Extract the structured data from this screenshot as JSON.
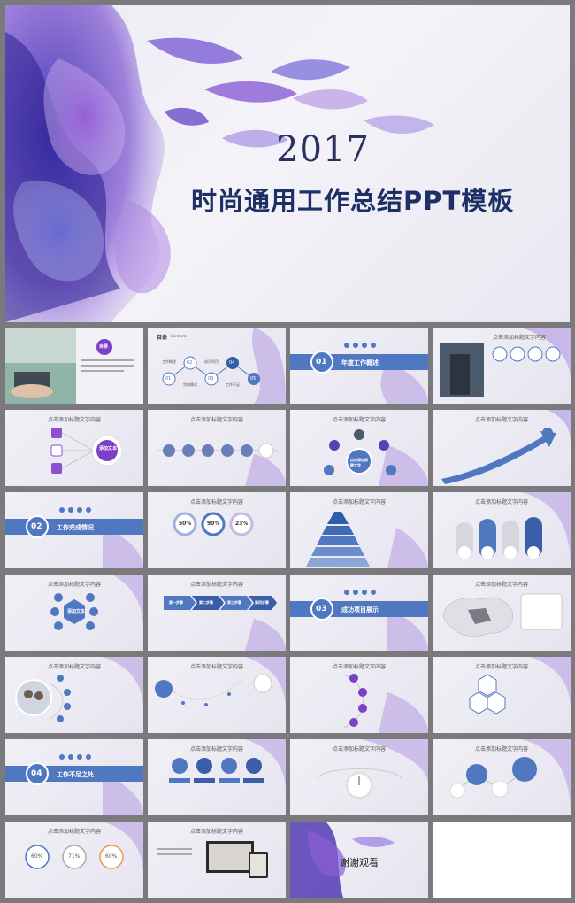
{
  "cover": {
    "year": "2017",
    "title": "时尚通用工作总结PPT模板"
  },
  "colors": {
    "accent": "#4f78c0",
    "violet": "#7b4fc8",
    "navy": "#1e2f66"
  },
  "thumbs": {
    "t1": {
      "badge": "目录"
    },
    "t2": {
      "title": "目录",
      "sub": "Contents",
      "n1": "01",
      "n2": "02",
      "n3": "03",
      "n4": "04",
      "n5": "05",
      "l1": "工作概述",
      "l2": "完成情况",
      "l3": "成功项目",
      "l4": "工作不足"
    },
    "t3": {
      "num": "01",
      "label": "年度工作概述"
    },
    "t4": {
      "heading": "点击添加标题文字内容"
    },
    "t5": {
      "heading": "点击添加标题文字内容",
      "center": "添加文本"
    },
    "t6": {
      "heading": "点击添加标题文字内容"
    },
    "t7": {
      "heading": "点击添加标题文字内容",
      "center": "点击添加标题文字"
    },
    "t8": {
      "heading": "点击添加标题文字内容"
    },
    "t9": {
      "num": "02",
      "label": "工作完成情况"
    },
    "t10": {
      "heading": "点击添加标题文字内容",
      "p1": "50%",
      "p2": "90%",
      "p3": "23%"
    },
    "t11": {
      "heading": "点击添加标题文字内容"
    },
    "t12": {
      "heading": "点击添加标题文字内容"
    },
    "t13": {
      "heading": "点击添加标题文字内容",
      "center": "添加文本"
    },
    "t14": {
      "heading": "点击添加标题文字内容",
      "a1": "第一步骤",
      "a2": "第二步骤",
      "a3": "第三步骤",
      "a4": "第四步骤"
    },
    "t15": {
      "num": "03",
      "label": "成功项目展示"
    },
    "t16": {
      "heading": "点击添加标题文字内容"
    },
    "t17": {
      "heading": "点击添加标题文字内容"
    },
    "t18": {
      "heading": "点击添加标题文字内容"
    },
    "t19": {
      "heading": "点击添加标题文字内容"
    },
    "t20": {
      "heading": "点击添加标题文字内容"
    },
    "t21": {
      "num": "04",
      "label": "工作不足之处"
    },
    "t22": {
      "heading": "点击添加标题文字内容"
    },
    "t23": {
      "heading": "点击添加标题文字内容"
    },
    "t24": {
      "heading": "点击添加标题文字内容"
    },
    "t25": {
      "heading": "点击添加标题文字内容",
      "p1": "60%",
      "p2": "71%",
      "p3": "60%"
    },
    "t26": {
      "heading": "点击添加标题文字内容"
    },
    "t27": {
      "thanks": "谢谢观看"
    }
  }
}
